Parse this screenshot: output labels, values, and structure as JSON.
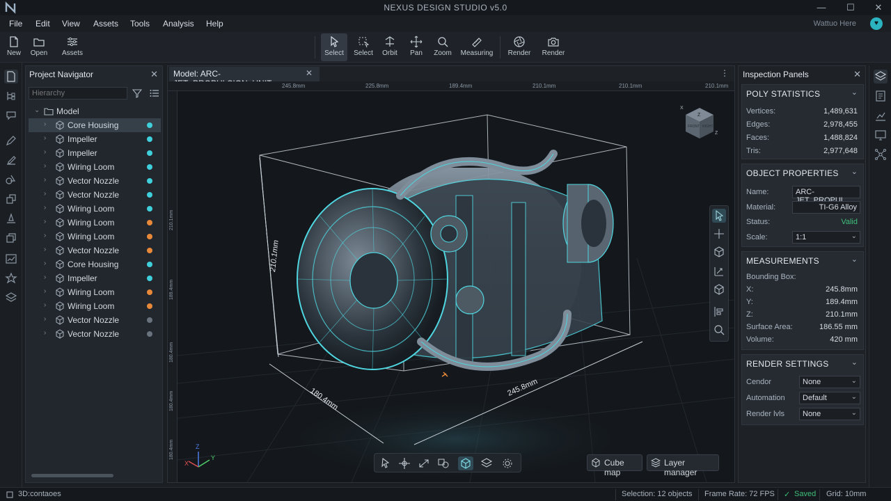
{
  "app": {
    "title": "NEXUS DESIGN STUDIO v5.0",
    "user_name": "Wattuo Here",
    "user_initial": "♥"
  },
  "menu": [
    "File",
    "Edit",
    "View",
    "Assets",
    "Tools",
    "Analysis",
    "Help"
  ],
  "toolbar": {
    "left": [
      {
        "label": "New",
        "icon": "file-icon"
      },
      {
        "label": "Open",
        "icon": "folder-icon"
      },
      {
        "label": "Assets",
        "icon": "sliders-icon"
      }
    ],
    "center": [
      {
        "label": "Select",
        "icon": "cursor-icon",
        "active": true
      },
      {
        "label": "Select",
        "icon": "lasso-icon"
      },
      {
        "label": "Orbit",
        "icon": "orbit-icon"
      },
      {
        "label": "Pan",
        "icon": "pan-icon"
      },
      {
        "label": "Zoom",
        "icon": "zoom-icon"
      },
      {
        "label": "Measuring",
        "icon": "ruler-icon"
      }
    ],
    "right": [
      {
        "label": "Render",
        "icon": "aperture-icon"
      },
      {
        "label": "Render",
        "icon": "camera-icon"
      }
    ]
  },
  "navigator": {
    "title": "Project Navigator",
    "search_placeholder": "Hierarchy",
    "root": "Model",
    "items": [
      {
        "label": "Core Housing",
        "status": "cyan",
        "selected": true
      },
      {
        "label": "Impeller",
        "status": "cyan"
      },
      {
        "label": "Impeller",
        "status": "cyan"
      },
      {
        "label": "Wiring Loom",
        "status": "cyan"
      },
      {
        "label": "Vector Nozzle",
        "status": "cyan"
      },
      {
        "label": "Vector Nozzle",
        "status": "cyan"
      },
      {
        "label": "Wiring Loom",
        "status": "cyan"
      },
      {
        "label": "Wiring Loom",
        "status": "orange"
      },
      {
        "label": "Wiring Loom",
        "status": "orange"
      },
      {
        "label": "Vector Nozzle",
        "status": "orange"
      },
      {
        "label": "Core Housing",
        "status": "cyan"
      },
      {
        "label": "Impeller",
        "status": "cyan"
      },
      {
        "label": "Wiring Loom",
        "status": "orange"
      },
      {
        "label": "Wiring Loom",
        "status": "orange"
      },
      {
        "label": "Vector Nozzle",
        "status": "gray"
      },
      {
        "label": "Vector Nozzle",
        "status": "gray"
      }
    ]
  },
  "viewport": {
    "tab_label": "Model: ARC-JET_PROPULSION_UNIT",
    "ruler_top": [
      "245.8mm",
      "225.8mm",
      "189.4mm",
      "210.1mm",
      "210.1mm",
      "210.1mm"
    ],
    "ruler_left": [
      "210.1mm",
      "189.4mm",
      "180.4mm",
      "180.4mm",
      "180.4mm",
      "0mm"
    ],
    "dim_height": "210.1mm",
    "dim_depth": "180.4mm",
    "dim_width": "245.8mm",
    "cube_faces": {
      "top": "Z",
      "front": "FRONT",
      "right": "RIGHT"
    },
    "cube_axes": {
      "x": "X",
      "z": "Z"
    },
    "axis_labels": {
      "x": "X",
      "y": "Y",
      "z": "Z"
    },
    "chips": {
      "cube_map": "Cube map",
      "layer_manager": "Layer manager"
    }
  },
  "inspection": {
    "title": "Inspection Panels",
    "poly": {
      "title": "POLY STATISTICS",
      "rows": [
        {
          "k": "Vertices:",
          "v": "1,489,631"
        },
        {
          "k": "Edges:",
          "v": "2,978,455"
        },
        {
          "k": "Faces:",
          "v": "1,488,824"
        },
        {
          "k": "Tris:",
          "v": "2,977,648"
        }
      ]
    },
    "object": {
      "title": "OBJECT PROPERTIES",
      "name_label": "Name:",
      "name_value": "ARC-JET_PROPUL",
      "material_label": "Material:",
      "material_value": "TI-G6 Alloy",
      "status_label": "Status:",
      "status_value": "Valid",
      "scale_label": "Scale:",
      "scale_value": "1:1"
    },
    "measure": {
      "title": "MEASUREMENTS",
      "bbox_label": "Bounding Box:",
      "rows": [
        {
          "k": "X:",
          "v": "245.8mm"
        },
        {
          "k": "Y:",
          "v": "189.4mm"
        },
        {
          "k": "Z:",
          "v": "210.1mm"
        },
        {
          "k": "Surface Area:",
          "v": "186.55 mm"
        },
        {
          "k": "Volume:",
          "v": "420 mm"
        }
      ]
    },
    "render": {
      "title": "RENDER SETTINGS",
      "rows": [
        {
          "k": "Cendor",
          "v": "None"
        },
        {
          "k": "Automation",
          "v": "Default"
        },
        {
          "k": "Render lvls",
          "v": "None"
        }
      ]
    }
  },
  "status": {
    "left": "3D:contaoes",
    "selection": "Selection: 12 objects",
    "fps": "Frame Rate: 72 FPS",
    "saved": "Saved",
    "grid": "Grid: 10mm"
  },
  "colors": {
    "accent": "#2bc4d0",
    "status_cyan": "#3fd0dc",
    "status_orange": "#e8893a",
    "status_gray": "#6a737d",
    "valid": "#3fbf7a"
  }
}
